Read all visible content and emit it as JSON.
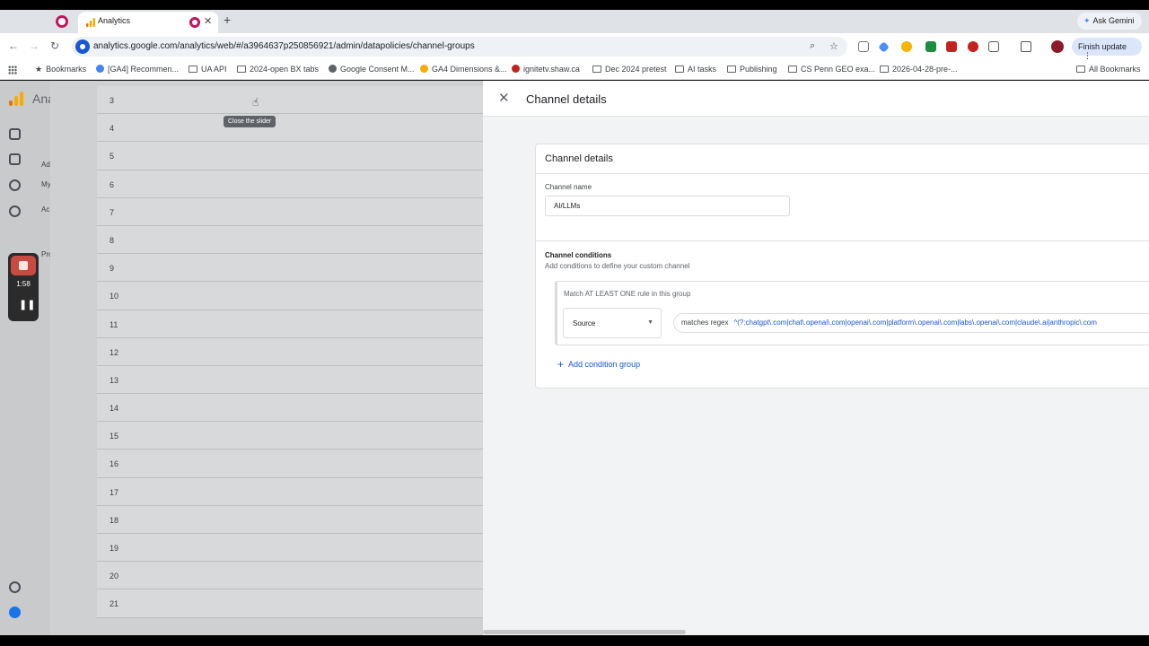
{
  "browser": {
    "tab_title": "Analytics",
    "url": "analytics.google.com/analytics/web/#/a3964637p250856921/admin/datapolicies/channel-groups",
    "ask_gemini": "Ask Gemini",
    "finish_update": "Finish update",
    "bookmarks": [
      "Bookmarks",
      "[GA4] Recommen...",
      "UA API",
      "2024-open BX tabs",
      "Google Consent M...",
      "GA4 Dimensions &...",
      "ignitetv.shaw.ca",
      "Dec 2024 pretest",
      "AI tasks",
      "Publishing",
      "CS Penn GEO exa...",
      "2026-04-28-pre-...",
      "All Bookmarks"
    ]
  },
  "ga": {
    "product": "Ana",
    "side_labels": [
      "Ad",
      "My",
      "Ac",
      "Pro"
    ]
  },
  "recorder": {
    "time": "1:58"
  },
  "list": {
    "rows": [
      "3",
      "4",
      "5",
      "6",
      "7",
      "8",
      "9",
      "10",
      "11",
      "12",
      "13",
      "14",
      "15",
      "16",
      "17",
      "18",
      "19",
      "20",
      "21"
    ],
    "tooltip": "Close the slider"
  },
  "drawer": {
    "title": "Channel details",
    "card_title": "Channel details",
    "channel_name_label": "Channel name",
    "channel_name_value": "AI/LLMs",
    "conditions_title": "Channel conditions",
    "conditions_subtitle": "Add conditions to define your custom channel",
    "group_rule": "Match AT LEAST ONE rule in this group",
    "dimension": "Source",
    "operator": "matches regex",
    "regex": "^(?:chatgpt\\.com|chat\\.openai\\.com|openai\\.com|platform\\.openai\\.com|labs\\.openai\\.com|claude\\.ai|anthropic\\.com",
    "add_group": "Add condition group"
  },
  "colors": {
    "accent_blue": "#1a56d6",
    "recorder_red": "#c94a43",
    "ga_orange": "#f9ab00"
  }
}
